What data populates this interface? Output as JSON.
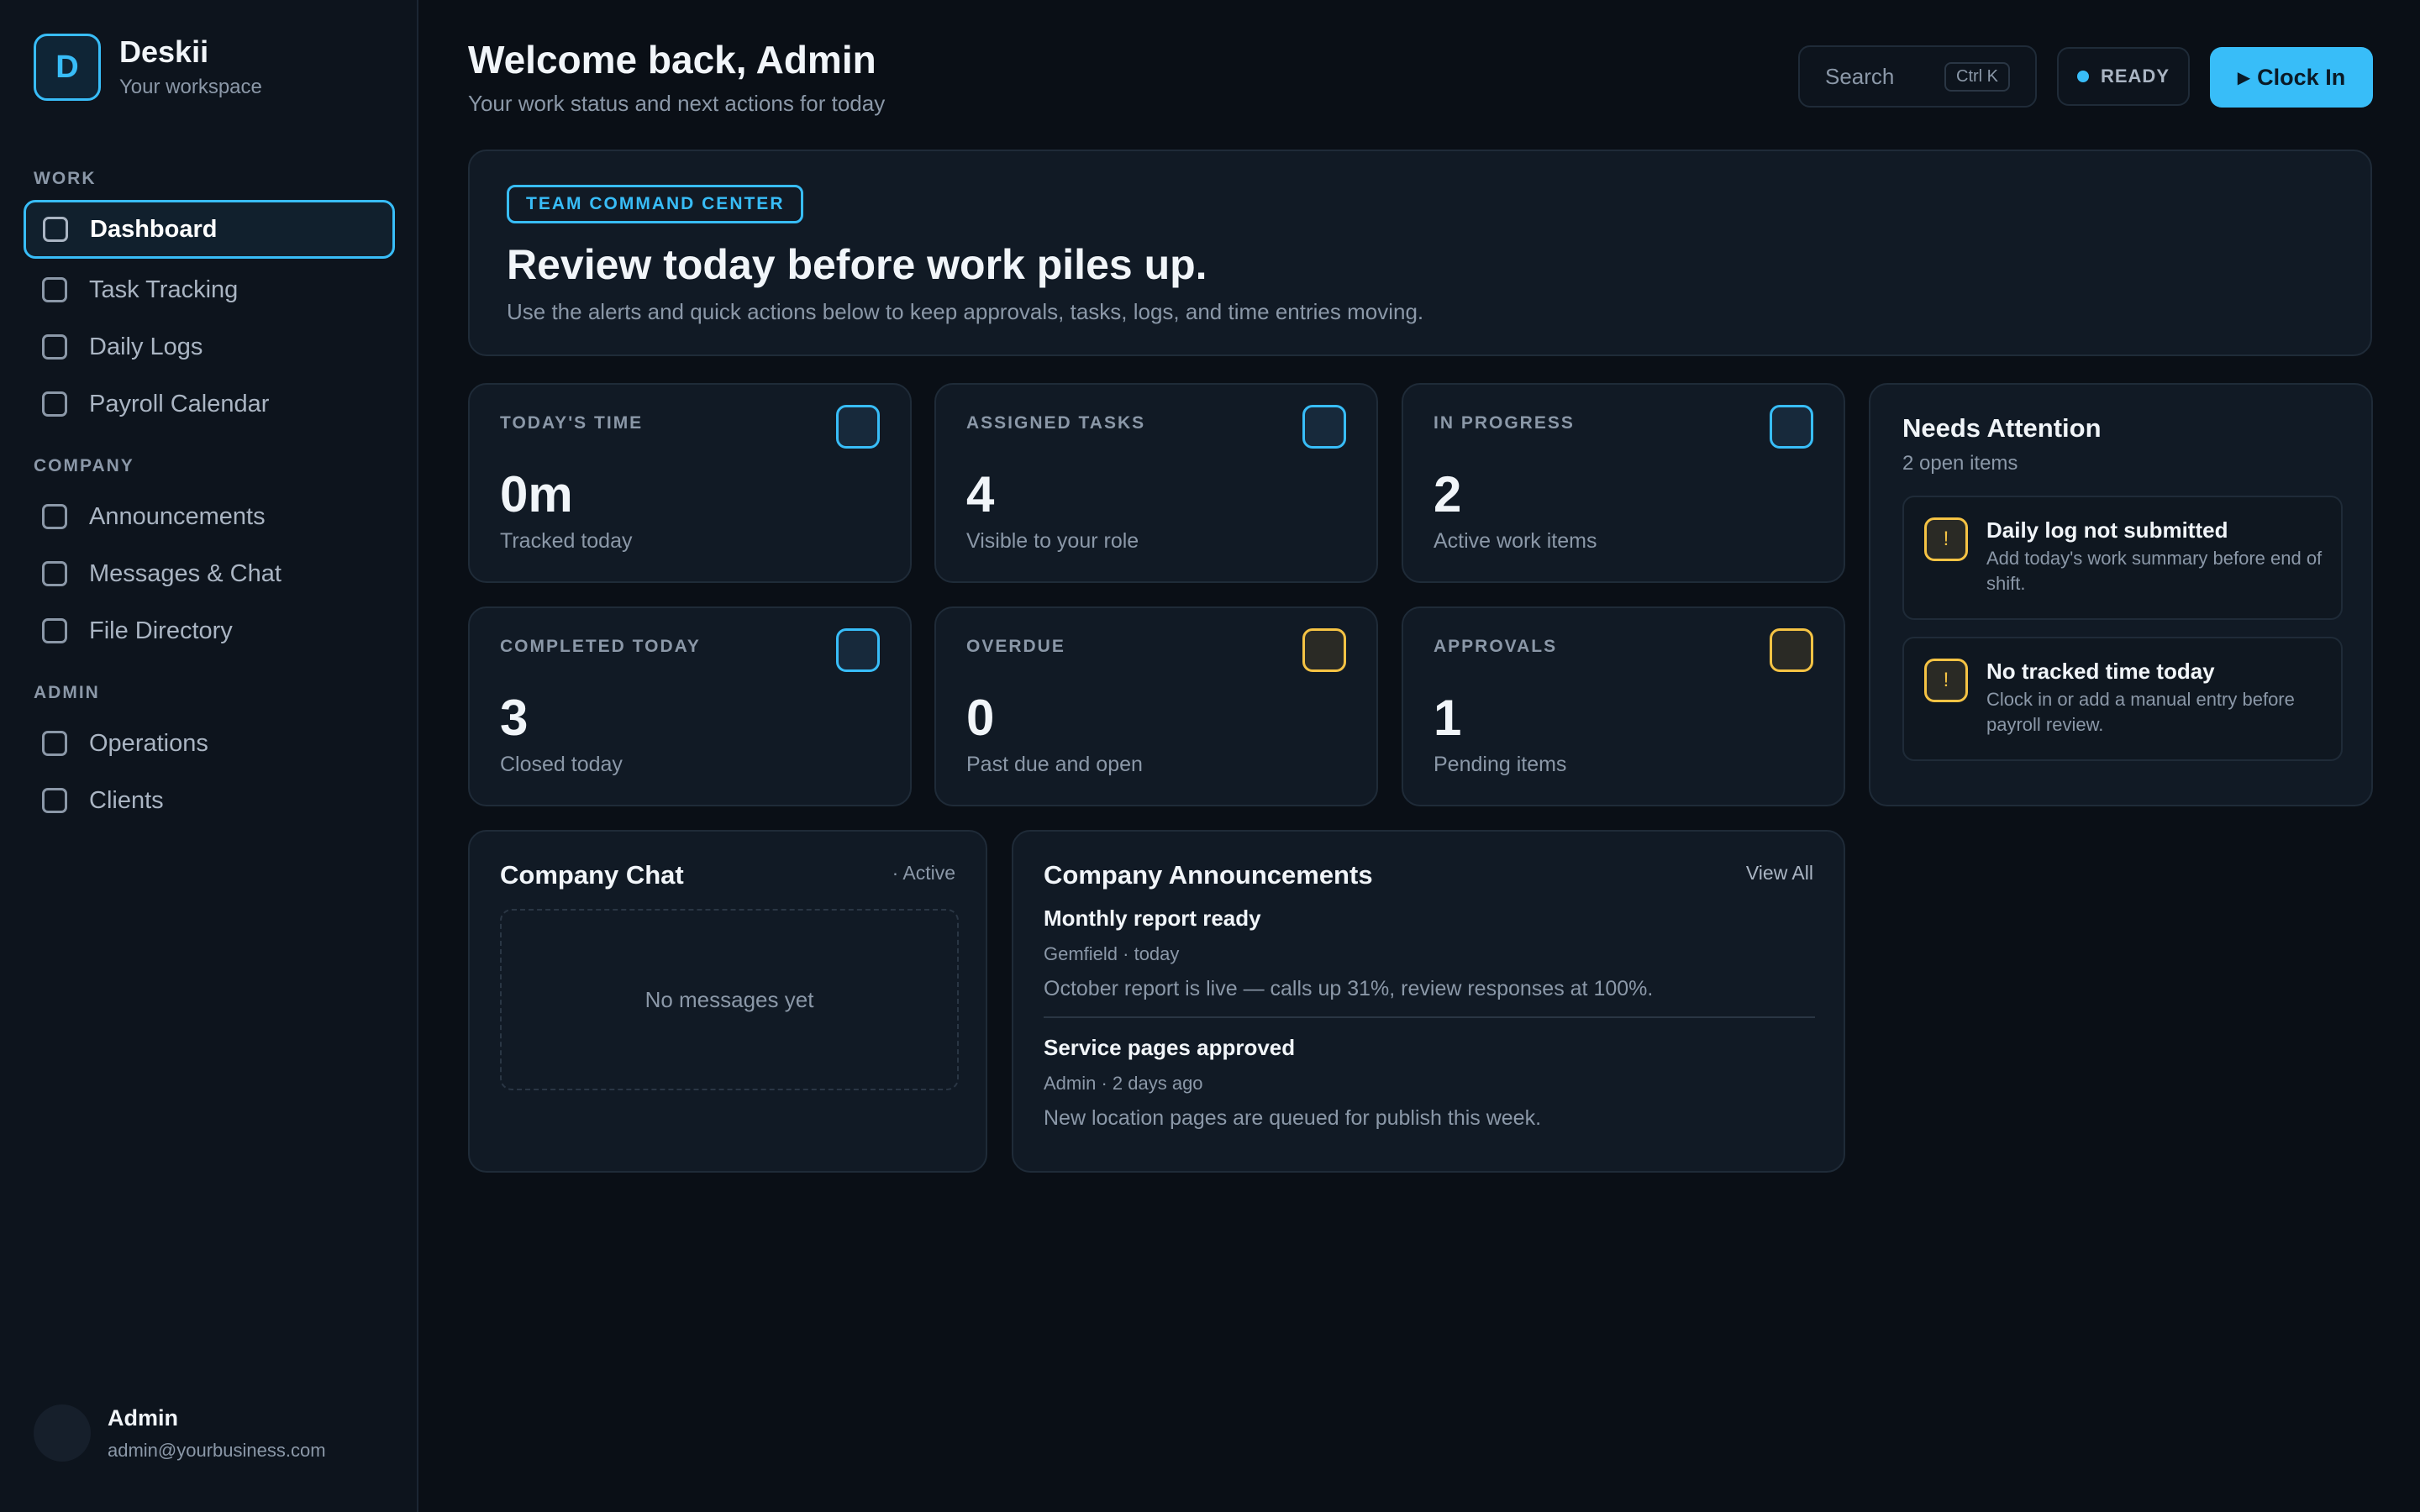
{
  "brand": {
    "logo_letter": "D",
    "name": "Deskii",
    "subtitle": "Your workspace"
  },
  "sidebar": {
    "sections": [
      {
        "label": "WORK"
      },
      {
        "label": "COMPANY"
      },
      {
        "label": "ADMIN"
      }
    ],
    "items": [
      {
        "label": "Dashboard",
        "active": true
      },
      {
        "label": "Task Tracking"
      },
      {
        "label": "Daily Logs"
      },
      {
        "label": "Payroll Calendar"
      },
      {
        "label": "Announcements"
      },
      {
        "label": "Messages & Chat"
      },
      {
        "label": "File Directory"
      },
      {
        "label": "Operations"
      },
      {
        "label": "Clients"
      }
    ]
  },
  "user": {
    "name": "Admin",
    "email": "admin@yourbusiness.com"
  },
  "header": {
    "title": "Welcome back, Admin",
    "subtitle": "Your work status and next actions for today",
    "search_placeholder": "Search",
    "search_shortcut": "Ctrl K",
    "status": "READY",
    "clock_in_label": "Clock In",
    "accent_color": "#38bdf8"
  },
  "hero": {
    "tag": "TEAM COMMAND CENTER",
    "title": "Review today before work piles up.",
    "subtitle": "Use the alerts and quick actions below to keep approvals, tasks, logs, and time entries moving."
  },
  "stats": [
    {
      "label": "TODAY'S TIME",
      "value": "0m",
      "desc": "Tracked today",
      "tone": "info"
    },
    {
      "label": "ASSIGNED TASKS",
      "value": "4",
      "desc": "Visible to your role",
      "tone": "info"
    },
    {
      "label": "IN PROGRESS",
      "value": "2",
      "desc": "Active work items",
      "tone": "info"
    },
    {
      "label": "COMPLETED TODAY",
      "value": "3",
      "desc": "Closed today",
      "tone": "info"
    },
    {
      "label": "OVERDUE",
      "value": "0",
      "desc": "Past due and open",
      "tone": "warning"
    },
    {
      "label": "APPROVALS",
      "value": "1",
      "desc": "Pending items",
      "tone": "warning"
    }
  ],
  "attention": {
    "title": "Needs Attention",
    "count": "2 open items",
    "items": [
      {
        "icon": "!",
        "title": "Daily log not submitted",
        "desc": "Add today's work summary before end of shift."
      },
      {
        "icon": "!",
        "title": "No tracked time today",
        "desc": "Clock in or add a manual entry before payroll review."
      }
    ],
    "warning_color": "#f5c344"
  },
  "chat": {
    "title": "Company Chat",
    "status": "· Active",
    "empty": "No messages yet"
  },
  "announcements": {
    "title": "Company Announcements",
    "view_all": "View All",
    "items": [
      {
        "title": "Monthly report ready",
        "meta": "Gemfield · today",
        "body": "October report is live — calls up 31%, review responses at 100%."
      },
      {
        "title": "Service pages approved",
        "meta": "Admin · 2 days ago",
        "body": "New location pages are queued for publish this week."
      }
    ]
  }
}
